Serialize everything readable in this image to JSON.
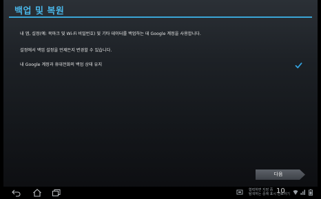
{
  "header": {
    "title": "백업 및 복원"
  },
  "content": {
    "description": "내 앱, 설정(예: 북마크 및 Wi-Fi 비밀번호) 및 기타 데이터를 백업하는 데 Google 계정을 사용합니다.",
    "change_later": "설정에서 백업 설정을 언제든지 변경할 수 있습니다.",
    "keep_backup_label": "내 Google 계정과 휴대전화의 백업 상태 유지",
    "keep_backup_checked": true
  },
  "footer": {
    "next_label": "다음"
  },
  "system_bar": {
    "status_line1": "협력하면 지장 중",
    "status_line2": "탐색하는 중에 표시 만료하기",
    "time": "10",
    "icons": [
      "back-icon",
      "home-icon",
      "recent-apps-icon",
      "screenshot-icon",
      "wifi-icon",
      "signal-icon",
      "battery-icon"
    ]
  },
  "colors": {
    "accent": "#3aa6d8",
    "title": "#4ab6e8",
    "check": "#33a3e0"
  }
}
